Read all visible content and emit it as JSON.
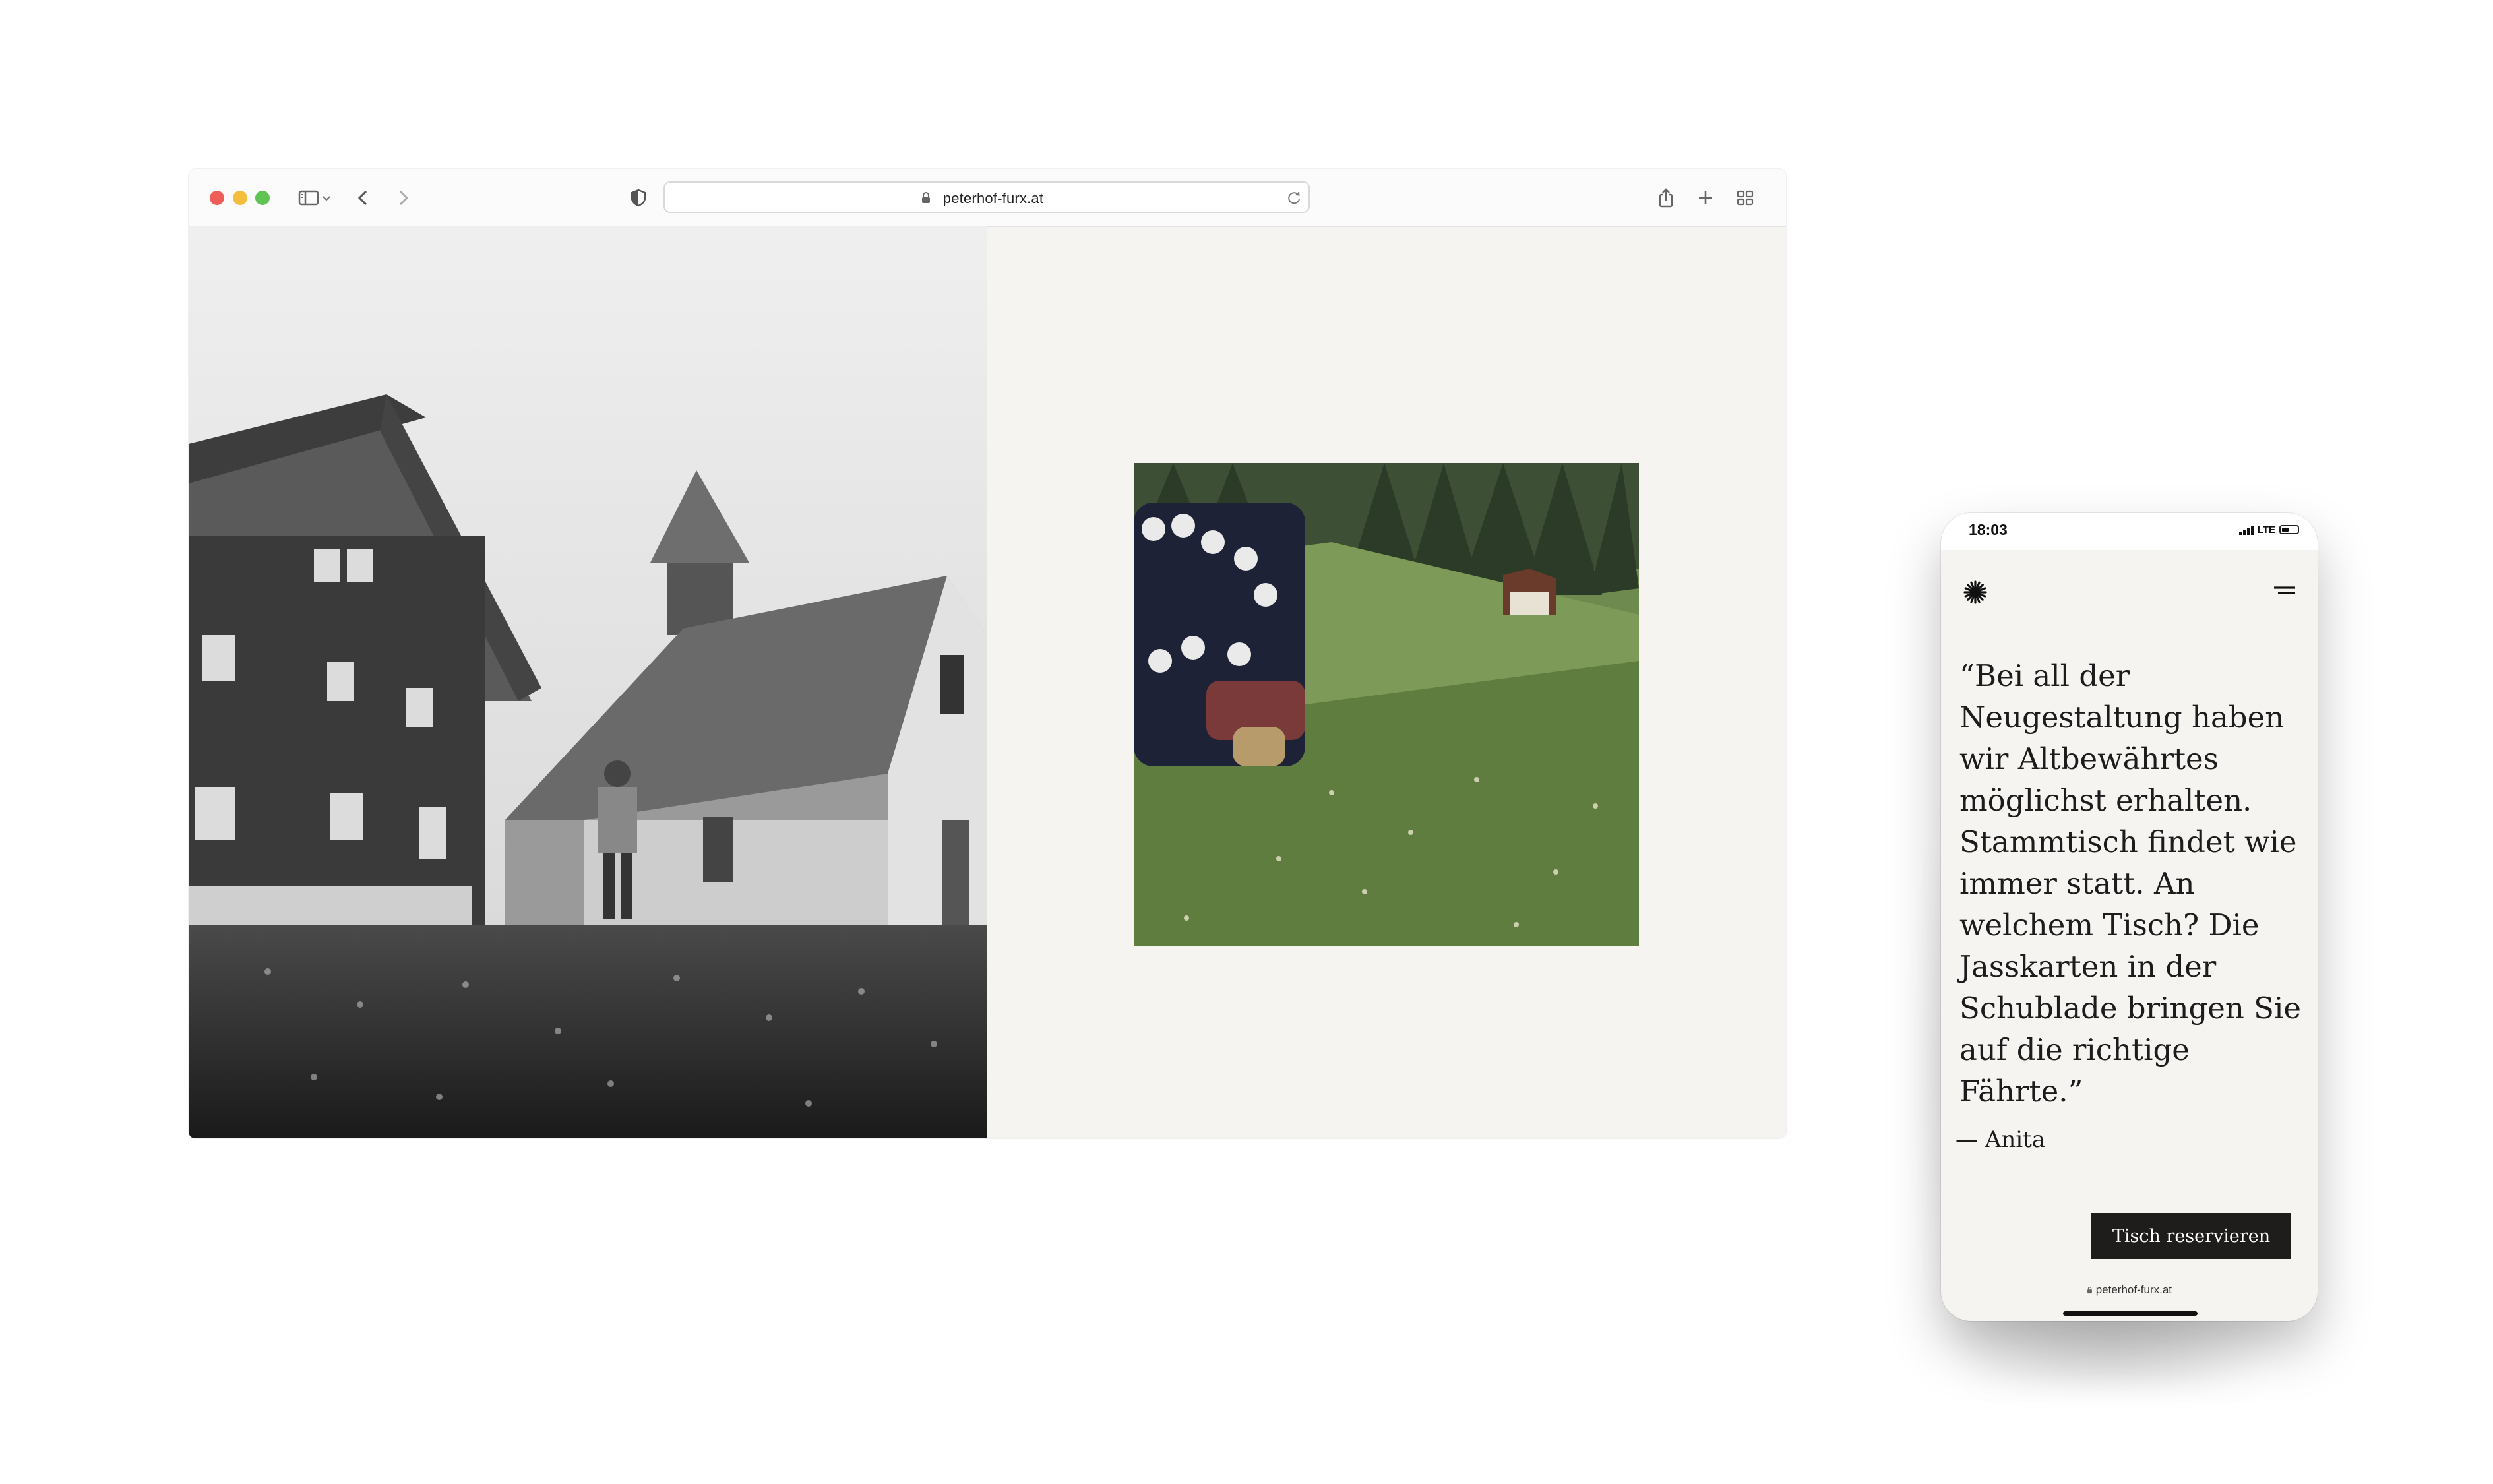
{
  "browser": {
    "url": "peterhof-furx.at",
    "window_controls": [
      "close",
      "minimize",
      "zoom"
    ],
    "toolbar_icons": [
      "sidebar-icon",
      "chevron-down-icon",
      "back-icon",
      "forward-icon",
      "shield-icon",
      "lock-icon",
      "reload-icon",
      "share-icon",
      "new-tab-icon",
      "tab-overview-icon"
    ]
  },
  "desktop_page": {
    "left_image": "black-and-white historic photo of farmhouse and chapel with boy in meadow",
    "right_image": "vintage color photo of group of nuns and children sitting on a grassy hillside"
  },
  "phone": {
    "status": {
      "time": "18:03",
      "network": "LTE"
    },
    "logo_icon": "asterisk-logo-icon",
    "menu_icon": "menu-icon",
    "quote": "“Bei all der Neugestaltung haben wir Altbewährtes möglichst erhalten. Stammtisch findet wie immer statt. An welchem Tisch? Die Jasskarten in der Schublade bringen Sie auf die richtige Fährte.”",
    "author": "— Anita",
    "cta_label": "Tisch reservieren",
    "url": "peterhof-furx.at"
  },
  "colors": {
    "page_bg": "#f6f4f1",
    "button_bg": "#1f1c1c",
    "button_text": "#ffffff",
    "text": "#1c1c1c"
  }
}
